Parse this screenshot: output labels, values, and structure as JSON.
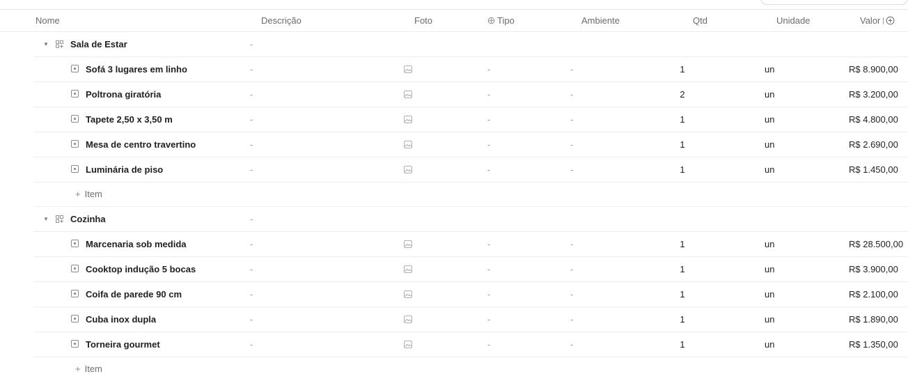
{
  "columns": {
    "nome": "Nome",
    "descricao": "Descrição",
    "foto": "Foto",
    "tipo": "Tipo",
    "ambiente": "Ambiente",
    "qtd": "Qtd",
    "unidade": "Unidade",
    "valor": "Valor"
  },
  "empty": "-",
  "add_item_label": "Item",
  "groups": [
    {
      "name": "Sala de Estar",
      "description": "-",
      "items": [
        {
          "name": "Sofá 3 lugares em linho",
          "descricao": "-",
          "tipo": "-",
          "ambiente": "-",
          "qtd": "1",
          "unidade": "un",
          "valor": "R$ 8.900,00"
        },
        {
          "name": "Poltrona giratória",
          "descricao": "-",
          "tipo": "-",
          "ambiente": "-",
          "qtd": "2",
          "unidade": "un",
          "valor": "R$ 3.200,00"
        },
        {
          "name": "Tapete 2,50 x 3,50 m",
          "descricao": "-",
          "tipo": "-",
          "ambiente": "-",
          "qtd": "1",
          "unidade": "un",
          "valor": "R$ 4.800,00"
        },
        {
          "name": "Mesa de centro travertino",
          "descricao": "-",
          "tipo": "-",
          "ambiente": "-",
          "qtd": "1",
          "unidade": "un",
          "valor": "R$ 2.690,00"
        },
        {
          "name": "Luminária de piso",
          "descricao": "-",
          "tipo": "-",
          "ambiente": "-",
          "qtd": "1",
          "unidade": "un",
          "valor": "R$ 1.450,00"
        }
      ]
    },
    {
      "name": "Cozinha",
      "description": "-",
      "items": [
        {
          "name": "Marcenaria sob medida",
          "descricao": "-",
          "tipo": "-",
          "ambiente": "-",
          "qtd": "1",
          "unidade": "un",
          "valor": "R$ 28.500,00"
        },
        {
          "name": "Cooktop indução 5 bocas",
          "descricao": "-",
          "tipo": "-",
          "ambiente": "-",
          "qtd": "1",
          "unidade": "un",
          "valor": "R$ 3.900,00"
        },
        {
          "name": "Coifa de parede 90 cm",
          "descricao": "-",
          "tipo": "-",
          "ambiente": "-",
          "qtd": "1",
          "unidade": "un",
          "valor": "R$ 2.100,00"
        },
        {
          "name": "Cuba inox dupla",
          "descricao": "-",
          "tipo": "-",
          "ambiente": "-",
          "qtd": "1",
          "unidade": "un",
          "valor": "R$ 1.890,00"
        },
        {
          "name": "Torneira gourmet",
          "descricao": "-",
          "tipo": "-",
          "ambiente": "-",
          "qtd": "1",
          "unidade": "un",
          "valor": "R$ 1.350,00"
        }
      ]
    }
  ],
  "icons": {
    "group": "group-grid-icon",
    "item": "item-square-icon",
    "photo": "image-icon",
    "tipo": "tag-icon",
    "add_column": "add-column-icon",
    "collapse": "caret-down-icon"
  },
  "colors": {
    "header_text": "#6b6b6b",
    "row_border": "#ededed",
    "muted": "#9b9b9b"
  }
}
